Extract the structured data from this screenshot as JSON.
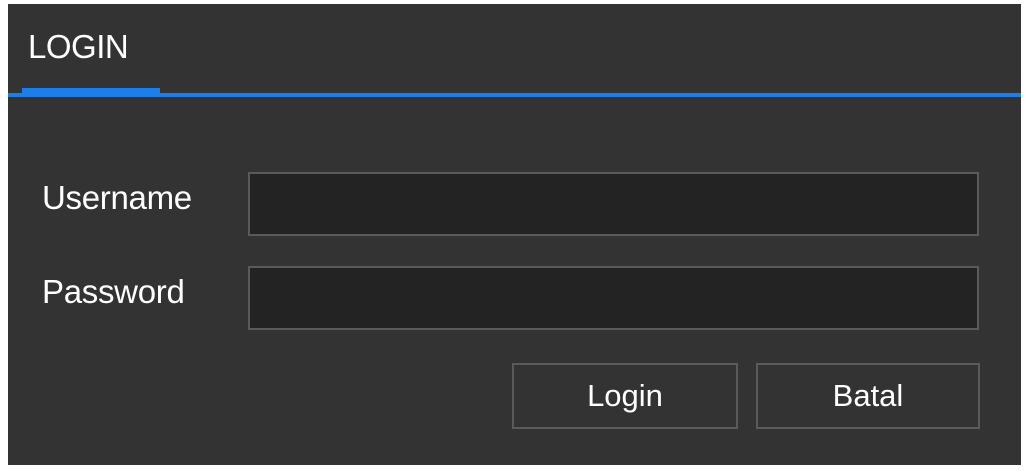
{
  "tabs": [
    {
      "label": "LOGIN",
      "active": true
    }
  ],
  "colors": {
    "background": "#333333",
    "accent": "#1e7ee8",
    "input_background": "#232323",
    "border": "#5a5a5a",
    "text": "#ffffff"
  },
  "form": {
    "username": {
      "label": "Username",
      "value": "",
      "placeholder": ""
    },
    "password": {
      "label": "Password",
      "value": "",
      "placeholder": ""
    }
  },
  "buttons": {
    "login_label": "Login",
    "cancel_label": "Batal"
  }
}
